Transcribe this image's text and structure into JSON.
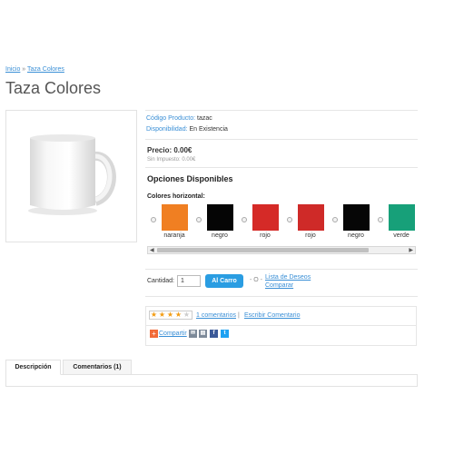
{
  "breadcrumb": {
    "home": "Inicio",
    "separator": "»",
    "current": "Taza Colores"
  },
  "product": {
    "title": "Taza Colores",
    "code_label": "Código Producto:",
    "code_value": "tazac",
    "availability_label": "Disponibilidad:",
    "availability_value": "En Existencia",
    "price": "Precio: 0.00€",
    "price_ex_tax": "Sin Impuesto: 0.00€"
  },
  "options": {
    "title": "Opciones Disponibles",
    "colors_label": "Colores horizontal:",
    "colors": [
      {
        "name": "naranja",
        "hex": "#f07f22"
      },
      {
        "name": "negro",
        "hex": "#050505"
      },
      {
        "name": "rojo",
        "hex": "#d52a27"
      },
      {
        "name": "rojo",
        "hex": "#cf2a28"
      },
      {
        "name": "negro",
        "hex": "#060606"
      },
      {
        "name": "verde",
        "hex": "#17a079"
      }
    ]
  },
  "cart": {
    "quantity_label": "Cantidad:",
    "quantity_value": "1",
    "add_button": "Al Carro",
    "or_text": "- O -",
    "wishlist_link": "Lista de Deseos",
    "compare_link": "Comparar"
  },
  "review": {
    "rating": 4,
    "max_rating": 5,
    "comments_link": "1 comentarios",
    "separator": "|",
    "write_link": "Escribir Comentario",
    "share_label": "Compartir",
    "share_icons": [
      "email-icon",
      "print-icon",
      "facebook-icon",
      "twitter-icon"
    ]
  },
  "tabs": [
    {
      "label": "Descripción",
      "active": true
    },
    {
      "label": "Comentarios (1)",
      "active": false
    }
  ],
  "colors": {
    "link": "#3a8fd6",
    "button": "#2a9de2",
    "share": "#f26b38",
    "star": "#f39c12"
  }
}
